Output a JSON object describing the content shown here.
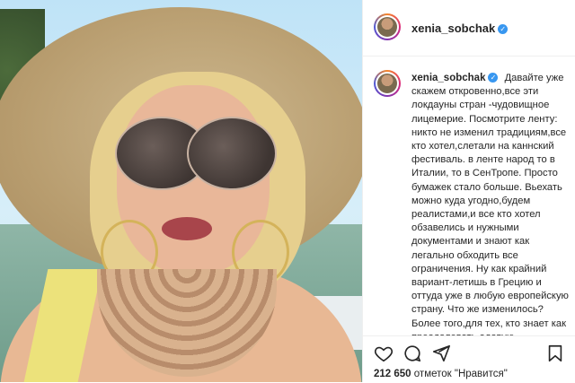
{
  "post": {
    "username": "xenia_sobchak",
    "verified_badge": "✓",
    "caption": "Давайте уже скажем откровенно,все эти локдауны стран -чудовищное лицемерие. Посмотрите ленту: никто не изменил традициям,все кто хотел,слетали на каннский фестиваль. в ленте народ то в Италии, то в СенТропе. Просто бумажек стало больше. Вьехать можно куда угодно,будем реалистами,и все кто хотел обзавелись и нужными документами и знают как легально обходить все ограничения. Ну как крайний вариант-летишь в Грецию и оттуда уже в любую европейскую страну. Что же изменилось? Более того,для тех, кто знает как преодолевать адовую бюрократию путешествовать по",
    "likes_count": "212 650",
    "likes_suffix": "отметок \"Нравится\""
  },
  "icons": {
    "avatar": "avatar-icon",
    "like": "heart-icon",
    "comment": "comment-icon",
    "share": "share-icon",
    "save": "bookmark-icon",
    "verified": "verified-badge-icon"
  },
  "colors": {
    "verified": "#3897f0",
    "text": "#262626",
    "divider": "#efefef"
  }
}
